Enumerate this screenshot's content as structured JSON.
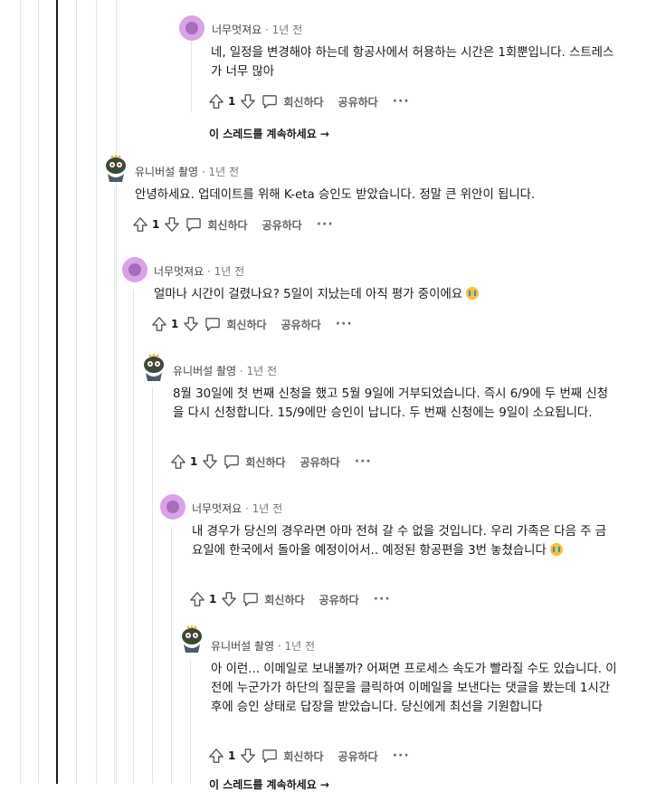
{
  "actions": {
    "reply": "회신하다",
    "share": "공유하다",
    "more": "···"
  },
  "continue_thread": "이 스레드를 계속하세요 →",
  "continue_thread_partial": "이 스레드를 계속하세요 →",
  "comments": [
    {
      "author": "너무멋져요",
      "time": "· 1년 전",
      "text": "네, 일정을 변경해야 하는데 항공사에서 허용하는 시간은 1회뿐입니다. 스트레스가 너무 많아",
      "votes": "1",
      "avatar": "reddit-pink-avatar"
    },
    {
      "author": "유니버설 촬영",
      "time": "· 1년 전",
      "text": "안녕하세요. 업데이트를 위해 K-eta 승인도 받았습니다. 정말 큰 위안이 됩니다.",
      "votes": "1",
      "avatar": "character-avatar"
    },
    {
      "author": "너무멋져요",
      "time": "· 1년 전",
      "text": "얼마나 시간이 걸렸나요? 5일이 지났는데 아직 평가 중이에요",
      "votes": "1",
      "avatar": "reddit-pink-avatar"
    },
    {
      "author": "유니버설 촬영",
      "time": "· 1년 전",
      "text": "8월 30일에 첫 번째 신청을 했고 5월 9일에 거부되었습니다. 즉시 6/9에 두 번째 신청을 다시 신청합니다. 15/9에만 승인이 납니다. 두 번째 신청에는 9일이 소요됩니다.",
      "votes": "1",
      "avatar": "character-avatar"
    },
    {
      "author": "너무멋져요",
      "time": "· 1년 전",
      "text": "내 경우가 당신의 경우라면 아마 전혀 갈 수 없을 것입니다. 우리 가족은 다음 주 금요일에 한국에서 돌아올 예정이어서.. 예정된 항공편을 3번 놓쳤습니다",
      "votes": "1",
      "avatar": "reddit-pink-avatar"
    },
    {
      "author": "유니버설 촬영",
      "time": "· 1년 전",
      "text": "아 이런... 이메일로 보내볼까? 어쩌면 프로세스 속도가 빨라질 수도 있습니다. 이전에 누군가가 하단의 질문을 클릭하여 이메일을 보낸다는 댓글을 봤는데 1시간 후에 승인 상태로 답장을 받았습니다. 당신에게 최선을 기원합니다",
      "votes": "1",
      "avatar": "character-avatar"
    }
  ]
}
